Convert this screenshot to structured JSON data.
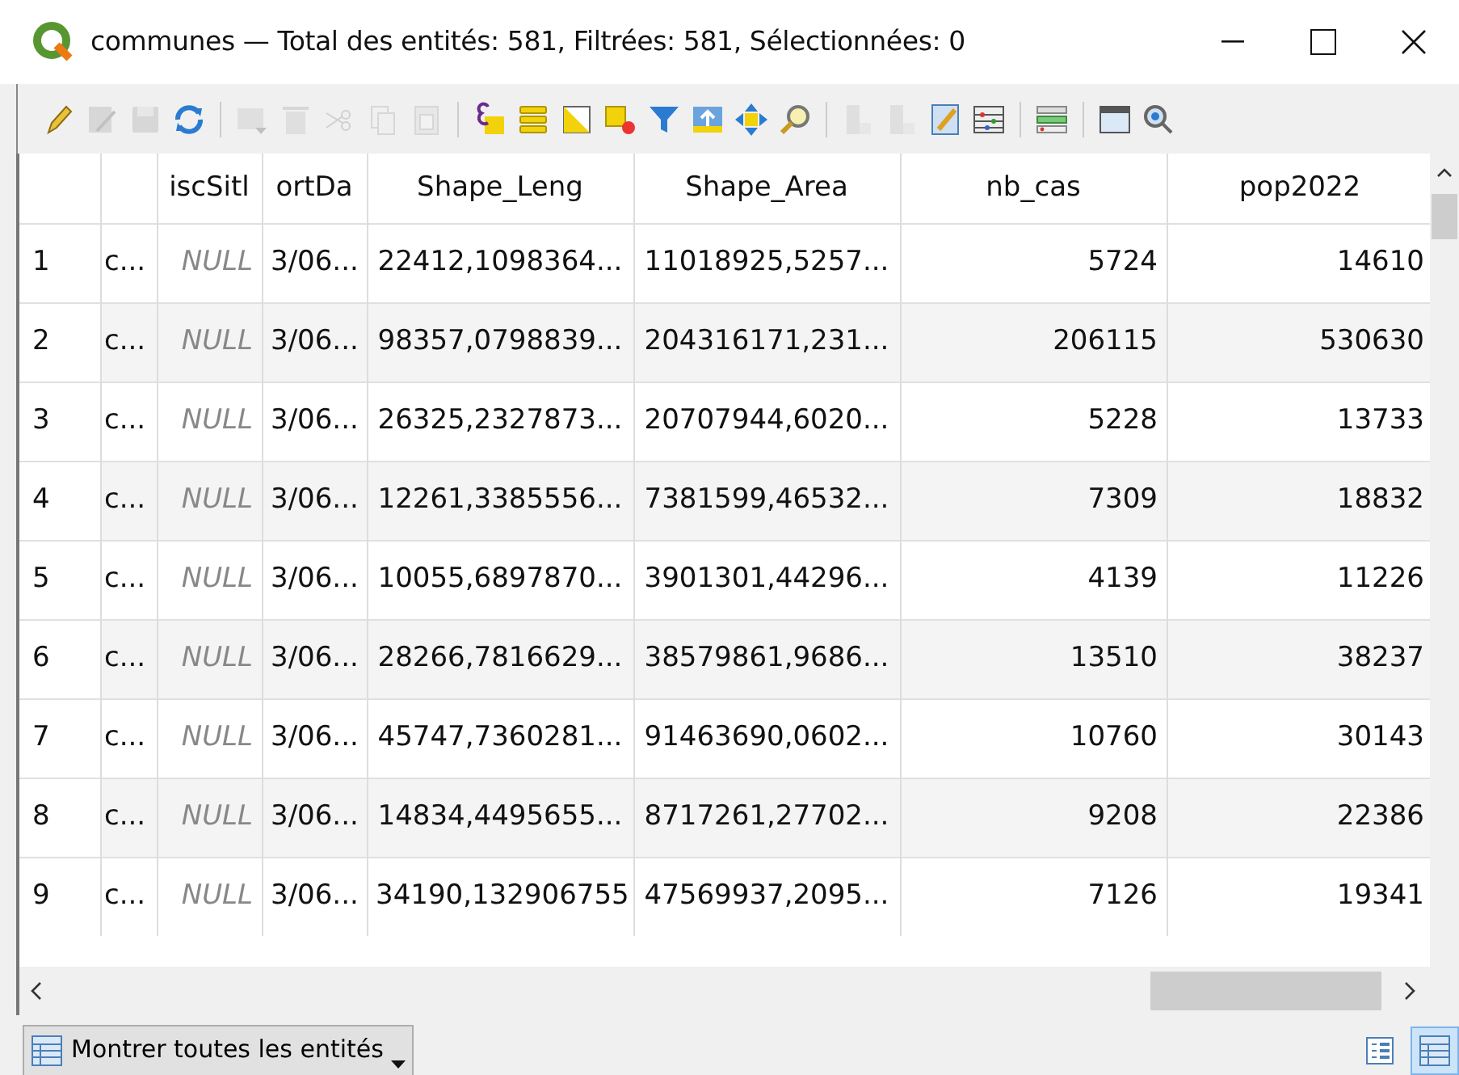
{
  "window": {
    "title": "communes — Total des entités: 581, Filtrées: 581, Sélectionnées: 0"
  },
  "toolbar": [
    {
      "kind": "pencil",
      "disabled": false
    },
    {
      "kind": "multiedit",
      "disabled": true
    },
    {
      "kind": "save",
      "disabled": true
    },
    {
      "kind": "refresh",
      "disabled": false
    },
    {
      "kind": "sep"
    },
    {
      "kind": "addrow",
      "disabled": true
    },
    {
      "kind": "trash",
      "disabled": true
    },
    {
      "kind": "cut",
      "disabled": true
    },
    {
      "kind": "copy",
      "disabled": true
    },
    {
      "kind": "paste",
      "disabled": true
    },
    {
      "kind": "sep"
    },
    {
      "kind": "exprselect",
      "disabled": false
    },
    {
      "kind": "selectall",
      "disabled": false
    },
    {
      "kind": "invert",
      "disabled": false
    },
    {
      "kind": "deselect",
      "disabled": false
    },
    {
      "kind": "filter",
      "disabled": false
    },
    {
      "kind": "totop",
      "disabled": false
    },
    {
      "kind": "pan",
      "disabled": false
    },
    {
      "kind": "zoom",
      "disabled": false
    },
    {
      "kind": "sep"
    },
    {
      "kind": "newfield",
      "disabled": true
    },
    {
      "kind": "delfield",
      "disabled": true
    },
    {
      "kind": "calc",
      "disabled": false
    },
    {
      "kind": "abacus",
      "disabled": false
    },
    {
      "kind": "sep"
    },
    {
      "kind": "actions",
      "disabled": false
    },
    {
      "kind": "sep"
    },
    {
      "kind": "dock",
      "disabled": false
    },
    {
      "kind": "search",
      "disabled": false
    }
  ],
  "table": {
    "columns": [
      {
        "kind": "text"
      },
      {
        "label": "iscSitl",
        "kind": "integer"
      },
      {
        "label": "ortDa",
        "kind": "text"
      },
      {
        "label": "Shape_Leng",
        "kind": "text"
      },
      {
        "label": "Shape_Area",
        "kind": "text"
      },
      {
        "label": "nb_cas",
        "kind": "integer"
      },
      {
        "label": "pop2022",
        "kind": "integer"
      }
    ],
    "rows": [
      {
        "number": "1",
        "cells": [
          {
            "text": "c...",
            "null": false
          },
          {
            "text": "NULL",
            "null": true
          },
          {
            "text": "3/06...",
            "null": false
          },
          {
            "text": "22412,1098364...",
            "null": false
          },
          {
            "text": "11018925,5257...",
            "null": false
          },
          {
            "text": "5724",
            "null": false
          },
          {
            "text": "14610",
            "null": false
          }
        ]
      },
      {
        "number": "2",
        "cells": [
          {
            "text": "c...",
            "null": false
          },
          {
            "text": "NULL",
            "null": true
          },
          {
            "text": "3/06...",
            "null": false
          },
          {
            "text": "98357,0798839...",
            "null": false
          },
          {
            "text": "204316171,231...",
            "null": false
          },
          {
            "text": "206115",
            "null": false
          },
          {
            "text": "530630",
            "null": false
          }
        ]
      },
      {
        "number": "3",
        "cells": [
          {
            "text": "c...",
            "null": false
          },
          {
            "text": "NULL",
            "null": true
          },
          {
            "text": "3/06...",
            "null": false
          },
          {
            "text": "26325,2327873...",
            "null": false
          },
          {
            "text": "20707944,6020...",
            "null": false
          },
          {
            "text": "5228",
            "null": false
          },
          {
            "text": "13733",
            "null": false
          }
        ]
      },
      {
        "number": "4",
        "cells": [
          {
            "text": "c...",
            "null": false
          },
          {
            "text": "NULL",
            "null": true
          },
          {
            "text": "3/06...",
            "null": false
          },
          {
            "text": "12261,3385556...",
            "null": false
          },
          {
            "text": "7381599,46532...",
            "null": false
          },
          {
            "text": "7309",
            "null": false
          },
          {
            "text": "18832",
            "null": false
          }
        ]
      },
      {
        "number": "5",
        "cells": [
          {
            "text": "c...",
            "null": false
          },
          {
            "text": "NULL",
            "null": true
          },
          {
            "text": "3/06...",
            "null": false
          },
          {
            "text": "10055,6897870...",
            "null": false
          },
          {
            "text": "3901301,44296...",
            "null": false
          },
          {
            "text": "4139",
            "null": false
          },
          {
            "text": "11226",
            "null": false
          }
        ]
      },
      {
        "number": "6",
        "cells": [
          {
            "text": "c...",
            "null": false
          },
          {
            "text": "NULL",
            "null": true
          },
          {
            "text": "3/06...",
            "null": false
          },
          {
            "text": "28266,7816629...",
            "null": false
          },
          {
            "text": "38579861,9686...",
            "null": false
          },
          {
            "text": "13510",
            "null": false
          },
          {
            "text": "38237",
            "null": false
          }
        ]
      },
      {
        "number": "7",
        "cells": [
          {
            "text": "c...",
            "null": false
          },
          {
            "text": "NULL",
            "null": true
          },
          {
            "text": "3/06...",
            "null": false
          },
          {
            "text": "45747,7360281...",
            "null": false
          },
          {
            "text": "91463690,0602...",
            "null": false
          },
          {
            "text": "10760",
            "null": false
          },
          {
            "text": "30143",
            "null": false
          }
        ]
      },
      {
        "number": "8",
        "cells": [
          {
            "text": "c...",
            "null": false
          },
          {
            "text": "NULL",
            "null": true
          },
          {
            "text": "3/06...",
            "null": false
          },
          {
            "text": "14834,4495655...",
            "null": false
          },
          {
            "text": "8717261,27702...",
            "null": false
          },
          {
            "text": "9208",
            "null": false
          },
          {
            "text": "22386",
            "null": false
          }
        ]
      },
      {
        "number": "9",
        "cells": [
          {
            "text": "c...",
            "null": false
          },
          {
            "text": "NULL",
            "null": true
          },
          {
            "text": "3/06...",
            "null": false
          },
          {
            "text": "34190,132906755",
            "null": false
          },
          {
            "text": "47569937,2095...",
            "null": false
          },
          {
            "text": "7126",
            "null": false
          },
          {
            "text": "19341",
            "null": false
          }
        ]
      }
    ]
  },
  "bottom_bar": {
    "filter_button": "Montrer toutes les entités",
    "views": [
      {
        "kind": "form",
        "selected": false
      },
      {
        "kind": "table",
        "selected": true
      }
    ]
  }
}
